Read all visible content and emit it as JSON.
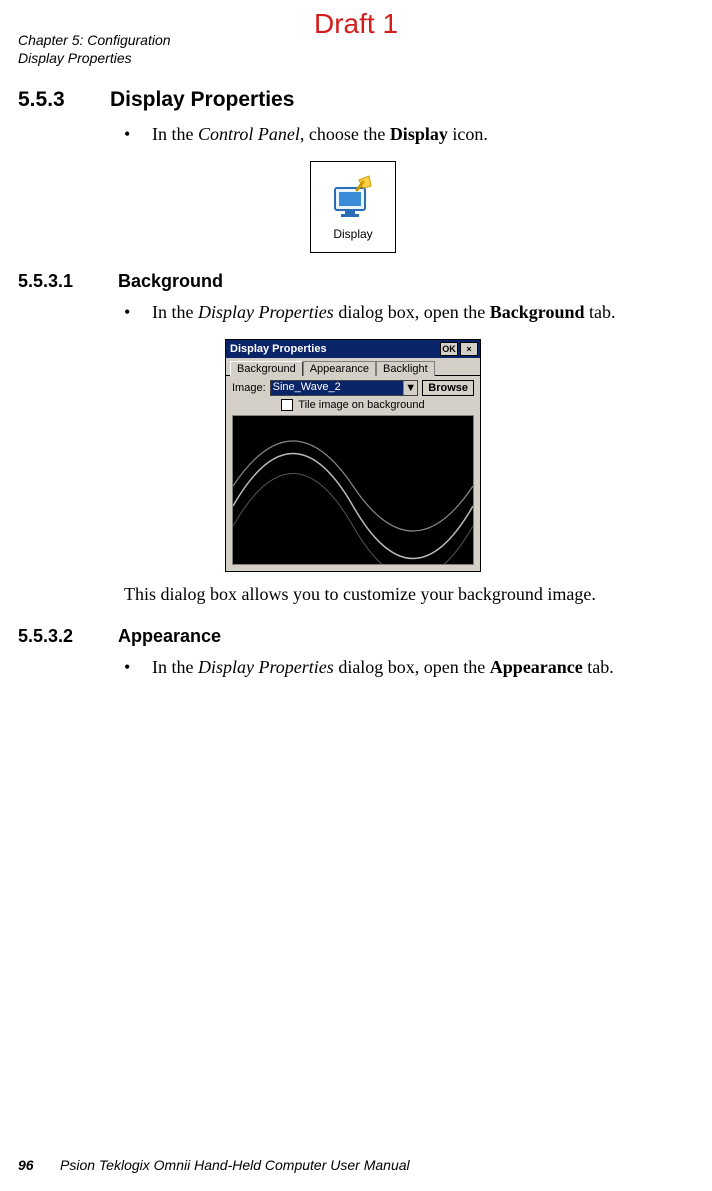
{
  "watermark": "Draft 1",
  "header": {
    "chapter": "Chapter 5: Configuration",
    "section": "Display Properties"
  },
  "sec553": {
    "num": "5.5.3",
    "title": "Display Properties",
    "bullet_prefix": "In the ",
    "bullet_italic": "Control Panel",
    "bullet_mid": ", choose the ",
    "bullet_bold": "Display",
    "bullet_suffix": " icon."
  },
  "display_icon": {
    "label": "Display"
  },
  "sec5531": {
    "num": "5.5.3.1",
    "title": "Background",
    "bullet_prefix": "In the ",
    "bullet_italic": "Display Properties",
    "bullet_mid": " dialog box, open the ",
    "bullet_bold": "Background",
    "bullet_suffix": " tab."
  },
  "dialog": {
    "title": "Display Properties",
    "ok": "OK",
    "close": "×",
    "tabs": {
      "t1": "Background",
      "t2": "Appearance",
      "t3": "Backlight"
    },
    "image_label": "Image:",
    "image_value": "Sine_Wave_2",
    "browse": "Browse",
    "tile_label": "Tile image on background"
  },
  "after_dialog": "This dialog box allows you to customize your background image.",
  "sec5532": {
    "num": "5.5.3.2",
    "title": "Appearance",
    "bullet_prefix": "In the ",
    "bullet_italic": "Display Properties",
    "bullet_mid": " dialog box, open the ",
    "bullet_bold": "Appearance",
    "bullet_suffix": " tab."
  },
  "footer": {
    "page": "96",
    "book": "Psion Teklogix Omnii Hand-Held Computer User Manual"
  }
}
